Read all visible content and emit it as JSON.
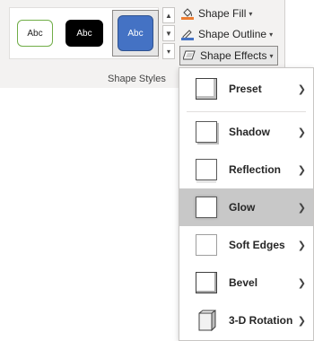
{
  "ribbon": {
    "gallery": {
      "swatches": [
        {
          "label": "Abc"
        },
        {
          "label": "Abc"
        },
        {
          "label": "Abc",
          "selected": true
        }
      ]
    },
    "group_label": "Shape Styles",
    "commands": {
      "fill": "Shape Fill",
      "outline": "Shape Outline",
      "effects": "Shape Effects"
    },
    "colors": {
      "fill_accent": "#ed7d31",
      "outline_accent": "#4472c4",
      "selected_swatch": "#4472c4"
    }
  },
  "menu": {
    "items": [
      {
        "label": "Preset",
        "icon": "preset-icon"
      },
      {
        "label": "Shadow",
        "icon": "shadow-icon"
      },
      {
        "label": "Reflection",
        "icon": "reflection-icon"
      },
      {
        "label": "Glow",
        "icon": "glow-icon",
        "highlighted": true
      },
      {
        "label": "Soft Edges",
        "icon": "soft-edges-icon"
      },
      {
        "label": "Bevel",
        "icon": "bevel-icon"
      },
      {
        "label": "3-D Rotation",
        "icon": "3d-rotation-icon"
      }
    ]
  }
}
